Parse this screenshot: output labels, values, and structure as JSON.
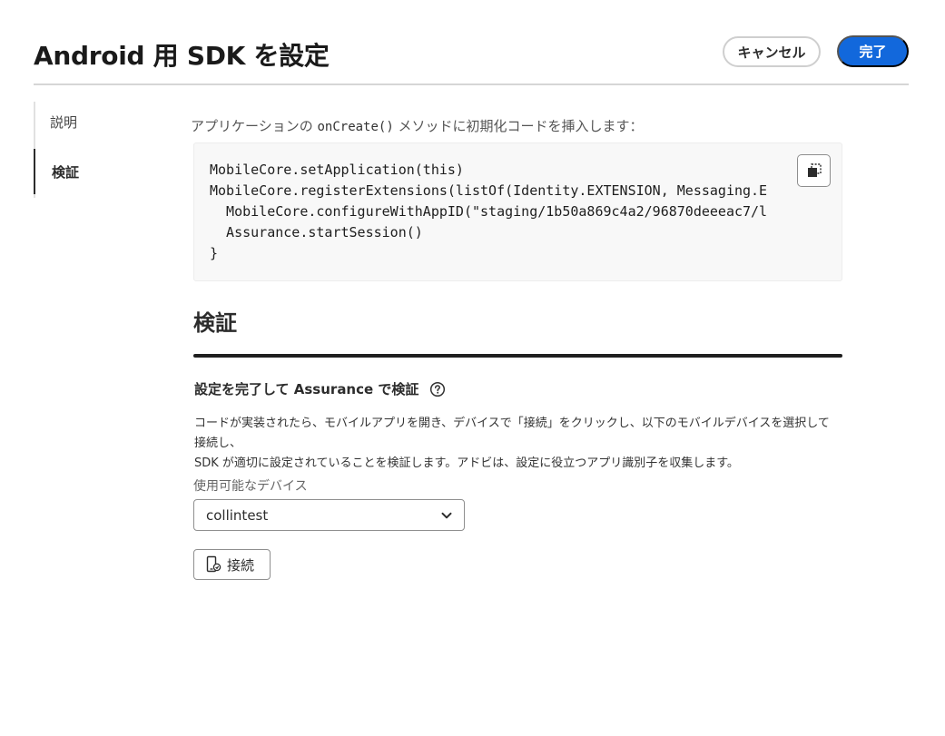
{
  "header": {
    "title": "Android 用 SDK を設定",
    "cancel_label": "キャンセル",
    "done_label": "完了",
    "done_color": "#1268dc"
  },
  "sidebar": {
    "items": [
      {
        "label": "説明",
        "active": false
      },
      {
        "label": "検証",
        "active": true
      }
    ]
  },
  "instructions": {
    "prefix": "アプリケーションの ",
    "code": "onCreate()",
    "suffix": " メソッドに初期化コードを挿入します："
  },
  "code_block": {
    "lines": [
      "MobileCore.setApplication(this)",
      "MobileCore.registerExtensions(listOf(Identity.EXTENSION, Messaging.E",
      "  MobileCore.configureWithAppID(\"staging/1b50a869c4a2/96870deeeac7/l",
      "  Assurance.startSession()",
      "}"
    ],
    "copy_icon": "copy-icon"
  },
  "verify": {
    "title": "検証",
    "subheading": "設定を完了して Assurance で検証",
    "help_icon": "help-circle-icon",
    "description_line1": "コードが実装されたら、モバイルアプリを開き、デバイスで「接続」をクリックし、以下のモバイルデバイスを選択して接続し、",
    "description_line2": "SDK が適切に設定されていることを検証します。アドビは、設定に役立つアプリ識別子を収集します。",
    "device_label": "使用可能なデバイス",
    "selected_device": "collintest",
    "connect_label": "接続"
  }
}
